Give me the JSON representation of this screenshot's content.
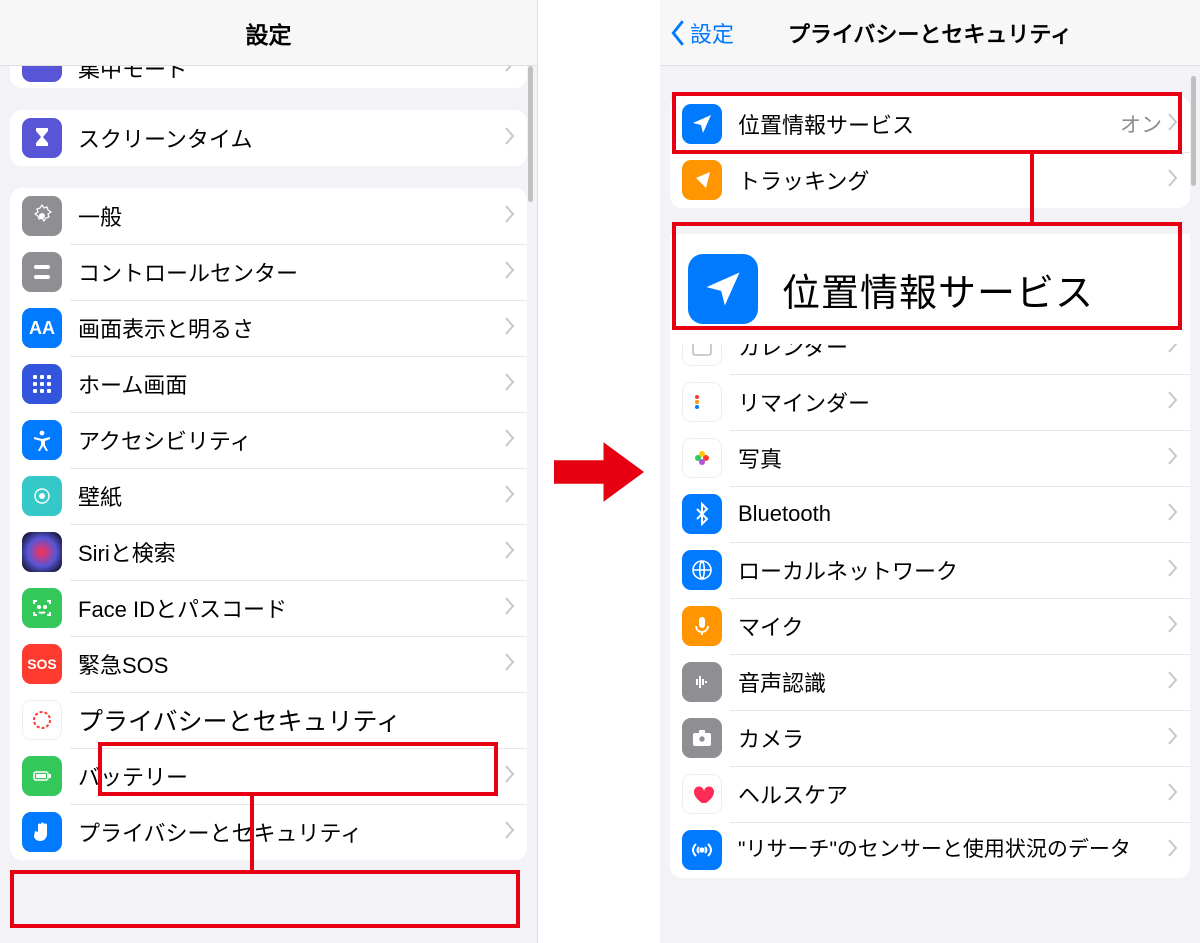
{
  "left": {
    "title": "設定",
    "partial_top_label": "集中モード",
    "screentime_label": "スクリーンタイム",
    "items": [
      {
        "label": "一般"
      },
      {
        "label": "コントロールセンター"
      },
      {
        "label": "画面表示と明るさ"
      },
      {
        "label": "ホーム画面"
      },
      {
        "label": "アクセシビリティ"
      },
      {
        "label": "壁紙"
      },
      {
        "label": "Siriと検索"
      },
      {
        "label": "Face IDとパスコード"
      },
      {
        "label": "緊急SOS"
      },
      {
        "label": "プライバシーとセキュリティ"
      },
      {
        "label": "バッテリー"
      },
      {
        "label": "プライバシーとセキュリティ"
      }
    ],
    "highlight_text": "プライバシーとセキュリティ"
  },
  "right": {
    "back_label": "設定",
    "title": "プライバシーとセキュリティ",
    "group1": [
      {
        "label": "位置情報サービス",
        "value": "オン"
      },
      {
        "label": "トラッキング"
      }
    ],
    "callout_label": "位置情報サービス",
    "group2": [
      {
        "label": "カレンダー"
      },
      {
        "label": "リマインダー"
      },
      {
        "label": "写真"
      },
      {
        "label": "Bluetooth"
      },
      {
        "label": "ローカルネットワーク"
      },
      {
        "label": "マイク"
      },
      {
        "label": "音声認識"
      },
      {
        "label": "カメラ"
      },
      {
        "label": "ヘルスケア"
      },
      {
        "label": "\"リサーチ\"のセンサーと使用状況のデータ"
      }
    ]
  }
}
